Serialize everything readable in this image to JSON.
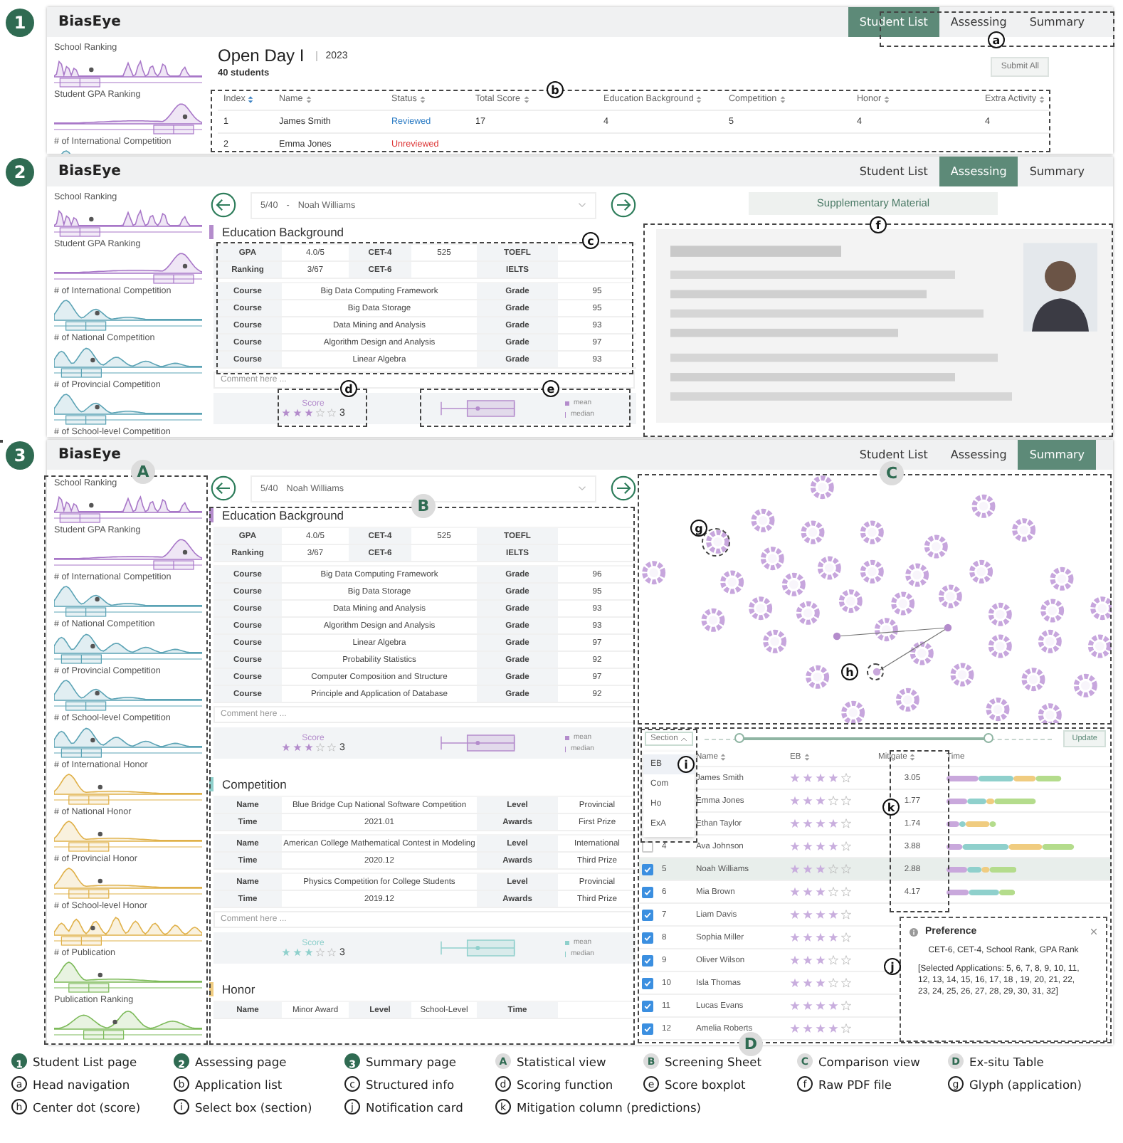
{
  "panels": [
    {
      "number": "1",
      "kind": "list",
      "brand": "BiasEye",
      "nav": [
        {
          "label": "Student List",
          "selected": true
        },
        {
          "label": "Assessing",
          "selected": false
        },
        {
          "label": "Summary",
          "selected": false
        }
      ],
      "sidebar": [
        {
          "title": "School Ranking",
          "color": "#a877c8"
        },
        {
          "title": "Student GPA Ranking",
          "color": "#a877c8"
        },
        {
          "title": "# of International Competition",
          "color": "#5ba3b5"
        }
      ],
      "event": {
        "title": "Open Day I",
        "year": "2023",
        "count": "40 students",
        "submit": "Submit All"
      },
      "table": {
        "columns": [
          {
            "label": "Index",
            "sorted": true
          },
          {
            "label": "Name",
            "sorted": false
          },
          {
            "label": "Status",
            "kind": "status",
            "sorted": false
          },
          {
            "label": "Total Score",
            "sorted": false
          },
          {
            "label": "Education Background",
            "sorted": false
          },
          {
            "label": "Competition",
            "sorted": false
          },
          {
            "label": "Honor",
            "sorted": false
          },
          {
            "label": "Extra Activity",
            "sorted": false
          }
        ],
        "rows": [
          {
            "reviewed": true,
            "cells": [
              "1",
              "James Smith",
              "Reviewed",
              "17",
              "4",
              "5",
              "4",
              "4"
            ]
          },
          {
            "reviewed": false,
            "cells": [
              "2",
              "Emma Jones",
              "Unreviewed"
            ]
          }
        ]
      },
      "annotations": [
        {
          "label": "a",
          "kind": "letter"
        },
        {
          "label": "b",
          "kind": "letter"
        }
      ]
    },
    {
      "number": "2",
      "kind": "assessing",
      "brand": "BiasEye",
      "nav": [
        {
          "label": "Student List",
          "selected": false
        },
        {
          "label": "Assessing",
          "selected": true
        },
        {
          "label": "Summary",
          "selected": false
        }
      ],
      "sidebar": [
        {
          "title": "School Ranking",
          "color": "#a877c8"
        },
        {
          "title": "Student GPA Ranking",
          "color": "#a877c8"
        },
        {
          "title": "# of International Competition",
          "color": "#5ba3b5"
        },
        {
          "title": "# of National Competition",
          "color": "#5ba3b5"
        },
        {
          "title": "# of Provincial Competition",
          "color": "#5ba3b5"
        },
        {
          "title": "# of School-level Competition"
        }
      ],
      "selector": {
        "position": "5/40",
        "separator": "-",
        "name": "Noah Williams"
      },
      "sheet": {
        "sections": [
          {
            "title": "Education Background",
            "color": "#b48ccc",
            "blocks": [
              [
                [
                  {
                    "kind": "key",
                    "text": "GPA"
                  },
                  {
                    "kind": "value",
                    "text": "4.0/5"
                  },
                  {
                    "kind": "key",
                    "text": "CET-4"
                  },
                  {
                    "kind": "value",
                    "text": "525"
                  },
                  {
                    "kind": "key",
                    "text": "TOEFL"
                  },
                  {
                    "kind": "value"
                  }
                ],
                [
                  {
                    "kind": "key",
                    "text": "Ranking"
                  },
                  {
                    "kind": "value",
                    "text": "3/67"
                  },
                  {
                    "kind": "key",
                    "text": "CET-6"
                  },
                  {
                    "kind": "value"
                  },
                  {
                    "kind": "key",
                    "text": "IELTS"
                  },
                  {
                    "kind": "value"
                  }
                ]
              ],
              [
                [
                  {
                    "kind": "key",
                    "text": "Course"
                  },
                  {
                    "kind": "value",
                    "text": "Big Data Computing Framework"
                  },
                  {
                    "kind": "key",
                    "text": "Grade"
                  },
                  {
                    "kind": "value",
                    "text": "95"
                  }
                ],
                [
                  {
                    "kind": "key",
                    "text": "Course"
                  },
                  {
                    "kind": "value",
                    "text": "Big Data Storage"
                  },
                  {
                    "kind": "key",
                    "text": "Grade"
                  },
                  {
                    "kind": "value",
                    "text": "95"
                  }
                ],
                [
                  {
                    "kind": "key",
                    "text": "Course"
                  },
                  {
                    "kind": "value",
                    "text": "Data Mining and Analysis"
                  },
                  {
                    "kind": "key",
                    "text": "Grade"
                  },
                  {
                    "kind": "value",
                    "text": "93"
                  }
                ],
                [
                  {
                    "kind": "key",
                    "text": "Course"
                  },
                  {
                    "kind": "value",
                    "text": "Algorithm Design and Analysis"
                  },
                  {
                    "kind": "key",
                    "text": "Grade"
                  },
                  {
                    "kind": "value",
                    "text": "97"
                  }
                ],
                [
                  {
                    "kind": "key",
                    "text": "Course"
                  },
                  {
                    "kind": "value",
                    "text": "Linear Algebra"
                  },
                  {
                    "kind": "key",
                    "text": "Grade"
                  },
                  {
                    "kind": "value",
                    "text": "93"
                  }
                ]
              ]
            ],
            "placeholder": "Comment here ...",
            "score": {
              "title": "Score",
              "stars": 3,
              "value": "3",
              "legend": [
                "mean",
                "median"
              ]
            }
          }
        ]
      },
      "supplementary": {
        "title": "Supplementary Material"
      },
      "annotations": [
        {
          "label": "c",
          "kind": "letter"
        },
        {
          "label": "d",
          "kind": "letter"
        },
        {
          "label": "e",
          "kind": "letter"
        },
        {
          "label": "f",
          "kind": "letter"
        }
      ]
    },
    {
      "number": "3",
      "kind": "summary",
      "brand": "BiasEye",
      "nav": [
        {
          "label": "Student List",
          "selected": false
        },
        {
          "label": "Assessing",
          "selected": false
        },
        {
          "label": "Summary",
          "selected": true
        }
      ],
      "sidebar": [
        {
          "title": "School Ranking",
          "color": "#a877c8"
        },
        {
          "title": "Student GPA Ranking",
          "color": "#a877c8"
        },
        {
          "title": "# of International Competition",
          "color": "#5ba3b5"
        },
        {
          "title": "# of National Competition",
          "color": "#5ba3b5"
        },
        {
          "title": "# of Provincial Competition",
          "color": "#5ba3b5"
        },
        {
          "title": "# of School-level Competition",
          "color": "#5ba3b5"
        },
        {
          "title": "# of International Honor",
          "color": "#e0b14a"
        },
        {
          "title": "# of National Honor",
          "color": "#e0b14a"
        },
        {
          "title": "# of Provincial Honor",
          "color": "#e0b14a"
        },
        {
          "title": "# of School-level Honor",
          "color": "#e0b14a"
        },
        {
          "title": "# of Publication",
          "color": "#7dba5a"
        },
        {
          "title": "Publication Ranking",
          "color": "#7dba5a"
        }
      ],
      "selector": {
        "position": "5/40",
        "name": "Noah Williams"
      },
      "sheet": {
        "sections": [
          {
            "title": "Education Background",
            "color": "#b48ccc",
            "blocks": [
              [
                [
                  {
                    "kind": "key",
                    "text": "GPA"
                  },
                  {
                    "kind": "value",
                    "text": "4.0/5"
                  },
                  {
                    "kind": "key",
                    "text": "CET-4"
                  },
                  {
                    "kind": "value",
                    "text": "525"
                  },
                  {
                    "kind": "key",
                    "text": "TOEFL"
                  },
                  {
                    "kind": "value"
                  }
                ],
                [
                  {
                    "kind": "key",
                    "text": "Ranking"
                  },
                  {
                    "kind": "value",
                    "text": "3/67"
                  },
                  {
                    "kind": "key",
                    "text": "CET-6"
                  },
                  {
                    "kind": "value"
                  },
                  {
                    "kind": "key",
                    "text": "IELTS"
                  },
                  {
                    "kind": "value"
                  }
                ]
              ],
              [
                [
                  {
                    "kind": "key",
                    "text": "Course"
                  },
                  {
                    "kind": "value",
                    "text": "Big Data Computing Framework"
                  },
                  {
                    "kind": "key",
                    "text": "Grade"
                  },
                  {
                    "kind": "value",
                    "text": "96"
                  }
                ],
                [
                  {
                    "kind": "key",
                    "text": "Course"
                  },
                  {
                    "kind": "value",
                    "text": "Big Data Storage"
                  },
                  {
                    "kind": "key",
                    "text": "Grade"
                  },
                  {
                    "kind": "value",
                    "text": "95"
                  }
                ],
                [
                  {
                    "kind": "key",
                    "text": "Course"
                  },
                  {
                    "kind": "value",
                    "text": "Data Mining and Analysis"
                  },
                  {
                    "kind": "key",
                    "text": "Grade"
                  },
                  {
                    "kind": "value",
                    "text": "93"
                  }
                ],
                [
                  {
                    "kind": "key",
                    "text": "Course"
                  },
                  {
                    "kind": "value",
                    "text": "Algorithm Design and Analysis"
                  },
                  {
                    "kind": "key",
                    "text": "Grade"
                  },
                  {
                    "kind": "value",
                    "text": "93"
                  }
                ],
                [
                  {
                    "kind": "key",
                    "text": "Course"
                  },
                  {
                    "kind": "value",
                    "text": "Linear Algebra"
                  },
                  {
                    "kind": "key",
                    "text": "Grade"
                  },
                  {
                    "kind": "value",
                    "text": "97"
                  }
                ],
                [
                  {
                    "kind": "key",
                    "text": "Course"
                  },
                  {
                    "kind": "value",
                    "text": "Probability Statistics"
                  },
                  {
                    "kind": "key",
                    "text": "Grade"
                  },
                  {
                    "kind": "value",
                    "text": "92"
                  }
                ],
                [
                  {
                    "kind": "key",
                    "text": "Course"
                  },
                  {
                    "kind": "value",
                    "text": "Computer Composition and Structure"
                  },
                  {
                    "kind": "key",
                    "text": "Grade"
                  },
                  {
                    "kind": "value",
                    "text": "97"
                  }
                ],
                [
                  {
                    "kind": "key",
                    "text": "Course"
                  },
                  {
                    "kind": "value",
                    "text": "Principle and Application of Database"
                  },
                  {
                    "kind": "key",
                    "text": "Grade"
                  },
                  {
                    "kind": "value",
                    "text": "92"
                  }
                ]
              ]
            ],
            "placeholder": "Comment here ...",
            "score": {
              "title": "Score",
              "stars": 3,
              "value": "3",
              "legend": [
                "mean",
                "median"
              ]
            }
          },
          {
            "title": "Competition",
            "color": "#8fd0cc",
            "blocks": [
              [
                [
                  {
                    "kind": "key",
                    "text": "Name"
                  },
                  {
                    "kind": "value",
                    "text": "Blue Bridge Cup National Software Competition"
                  },
                  {
                    "kind": "key",
                    "text": "Level"
                  },
                  {
                    "kind": "value",
                    "text": "Provincial"
                  }
                ],
                [
                  {
                    "kind": "key",
                    "text": "Time"
                  },
                  {
                    "kind": "value",
                    "text": "2021.01"
                  },
                  {
                    "kind": "key",
                    "text": "Awards"
                  },
                  {
                    "kind": "value",
                    "text": "First Prize"
                  }
                ]
              ],
              [
                [
                  {
                    "kind": "key",
                    "text": "Name"
                  },
                  {
                    "kind": "value",
                    "text": "American College Mathematical Contest in Modeling"
                  },
                  {
                    "kind": "key",
                    "text": "Level"
                  },
                  {
                    "kind": "value",
                    "text": "International"
                  }
                ],
                [
                  {
                    "kind": "key",
                    "text": "Time"
                  },
                  {
                    "kind": "value",
                    "text": "2020.12"
                  },
                  {
                    "kind": "key",
                    "text": "Awards"
                  },
                  {
                    "kind": "value",
                    "text": "Third Prize"
                  }
                ]
              ],
              [
                [
                  {
                    "kind": "key",
                    "text": "Name"
                  },
                  {
                    "kind": "value",
                    "text": "Physics Competition for College Students"
                  },
                  {
                    "kind": "key",
                    "text": "Level"
                  },
                  {
                    "kind": "value",
                    "text": "Provincial"
                  }
                ],
                [
                  {
                    "kind": "key",
                    "text": "Time"
                  },
                  {
                    "kind": "value",
                    "text": "2019.12"
                  },
                  {
                    "kind": "key",
                    "text": "Awards"
                  },
                  {
                    "kind": "value",
                    "text": "Third Prize"
                  }
                ]
              ]
            ],
            "placeholder": "Comment here ...",
            "score": {
              "title": "Score",
              "stars": 3,
              "value": "3",
              "legend": [
                "mean",
                "median"
              ]
            }
          },
          {
            "title": "Honor",
            "color": "#f0cc80",
            "blocks": [
              [
                [
                  {
                    "kind": "key",
                    "text": "Name"
                  },
                  {
                    "kind": "value",
                    "text": "Minor Award"
                  },
                  {
                    "kind": "key",
                    "text": "Level"
                  },
                  {
                    "kind": "value",
                    "text": "School-Level"
                  },
                  {
                    "kind": "key",
                    "text": "Time"
                  },
                  {
                    "kind": "value"
                  }
                ]
              ]
            ]
          }
        ]
      },
      "extable": {
        "section_label": "Section",
        "update": "Update",
        "range": [
          {
            "level": 0.1
          },
          {
            "level": 0.82
          }
        ],
        "options": [
          {
            "label": "EB",
            "selected": true
          },
          {
            "label": "Com",
            "selected": false
          },
          {
            "label": "Ho",
            "selected": false
          },
          {
            "label": "ExA",
            "selected": false
          }
        ],
        "columns": [
          {
            "label": "Name",
            "sortable": true
          },
          {
            "label": "EB",
            "sortable": true
          },
          {
            "label": "Mitigate",
            "sortable": true
          },
          {
            "label": "Time",
            "sortable": false
          }
        ],
        "rows": [
          {
            "name": "James Smith",
            "stars": 4,
            "mitigate": "3.05",
            "selected": false
          },
          {
            "name": "Emma Jones",
            "stars": 3,
            "mitigate": "1.77",
            "selected": false
          },
          {
            "name": "Ethan Taylor",
            "stars": 4,
            "mitigate": "1.74",
            "selected": false
          },
          {
            "index": "4",
            "checked": false,
            "name": "Ava Johnson",
            "stars": 4,
            "mitigate": "3.88",
            "selected": false
          },
          {
            "index": "5",
            "checked": true,
            "name": "Noah Williams",
            "stars": 3,
            "mitigate": "2.88",
            "selected": true
          },
          {
            "index": "6",
            "checked": true,
            "name": "Mia Brown",
            "stars": 3,
            "mitigate": "4.17",
            "selected": false
          },
          {
            "index": "7",
            "checked": true,
            "name": "Liam Davis",
            "stars": 4,
            "selected": false
          },
          {
            "index": "8",
            "checked": true,
            "name": "Sophia Miller",
            "stars": 4,
            "selected": false
          },
          {
            "index": "9",
            "checked": true,
            "name": "Oliver Wilson",
            "stars": 3,
            "selected": false
          },
          {
            "index": "10",
            "checked": true,
            "name": "Isla Thomas",
            "stars": 3,
            "selected": false
          },
          {
            "index": "11",
            "checked": true,
            "name": "Lucas Evans",
            "stars": 4,
            "selected": false
          },
          {
            "index": "12",
            "checked": true,
            "name": "Amelia Roberts",
            "stars": 4,
            "selected": false
          }
        ],
        "notification": {
          "title": "Preference",
          "body": "CET-6, CET-4, School Rank, GPA Rank",
          "detail": "[Selected Applications:  5, 6, 7, 8, 9, 10, 11, 12, 13, 14, 15, 16, 17, 18 , 19, 20, 21, 22, 23, 24, 25, 26, 27, 28, 29, 30, 31, 32]"
        }
      },
      "annotations": [
        {
          "label": "A",
          "kind": "view"
        },
        {
          "label": "B",
          "kind": "view"
        },
        {
          "label": "C",
          "kind": "view"
        },
        {
          "label": "g",
          "kind": "letter"
        },
        {
          "label": "h",
          "kind": "letter"
        },
        {
          "label": "D",
          "kind": "view"
        },
        {
          "label": "i",
          "kind": "letter"
        },
        {
          "label": "k",
          "kind": "letter"
        },
        {
          "label": "j",
          "kind": "letter"
        }
      ]
    }
  ],
  "legend": [
    {
      "badge": "1",
      "text": "Student List page",
      "kind": "page"
    },
    {
      "badge": "2",
      "text": "Assessing page",
      "kind": "page"
    },
    {
      "badge": "3",
      "text": "Summary page",
      "kind": "page"
    },
    {
      "badge": "A",
      "text": "Statistical view",
      "kind": "view"
    },
    {
      "badge": "B",
      "text": "Screening Sheet",
      "kind": "view"
    },
    {
      "badge": "C",
      "text": "Comparison view",
      "kind": "view"
    },
    {
      "badge": "D",
      "text": "Ex-situ Table",
      "kind": "view"
    },
    {
      "badge": "a",
      "text": "Head navigation",
      "kind": "part"
    },
    {
      "badge": "b",
      "text": "Application list",
      "kind": "part"
    },
    {
      "badge": "c",
      "text": "Structured info",
      "kind": "part"
    },
    {
      "badge": "d",
      "text": "Scoring function",
      "kind": "part"
    },
    {
      "badge": "e",
      "text": "Score boxplot",
      "kind": "part"
    },
    {
      "badge": "f",
      "text": "Raw PDF file",
      "kind": "part"
    },
    {
      "badge": "g",
      "text": "Glyph (application)",
      "kind": "part"
    },
    {
      "badge": "h",
      "text": "Center dot (score)",
      "kind": "part"
    },
    {
      "badge": "i",
      "text": "Select box (section)",
      "kind": "part"
    },
    {
      "badge": "j",
      "text": "Notification card",
      "kind": "part"
    },
    {
      "badge": "k",
      "text": "Mitigation column (predictions)",
      "kind": "part"
    }
  ]
}
